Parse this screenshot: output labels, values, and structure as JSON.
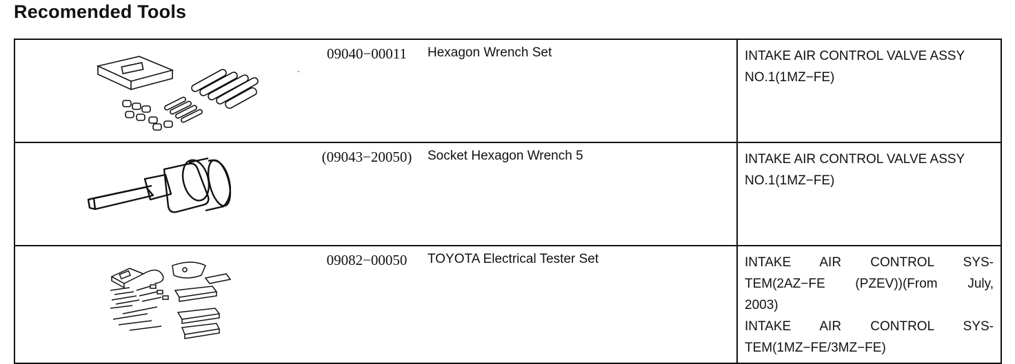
{
  "page": {
    "title": "Recomended Tools"
  },
  "tools": [
    {
      "part_no": "09040−00011",
      "name": "Hexagon Wrench Set",
      "applies": [
        "INTAKE AIR CONTROL VALVE ASSY NO.1(1MZ−FE)"
      ],
      "illustration": "hexagon-wrench-set"
    },
    {
      "part_no": "(09043−20050)",
      "name": "Socket Hexagon Wrench 5",
      "applies": [
        "INTAKE AIR CONTROL VALVE ASSY NO.1(1MZ−FE)"
      ],
      "illustration": "socket-hexagon-wrench"
    },
    {
      "part_no": "09082−00050",
      "name": "TOYOTA Electrical Tester Set",
      "applies": [
        "INTAKE AIR CONTROL SYS-",
        "TEM(2AZ−FE (PZEV))(From July,",
        "2003)",
        "INTAKE AIR CONTROL SYS-",
        "TEM(1MZ−FE/3MZ−FE)"
      ],
      "illustration": "electrical-tester-set"
    }
  ]
}
